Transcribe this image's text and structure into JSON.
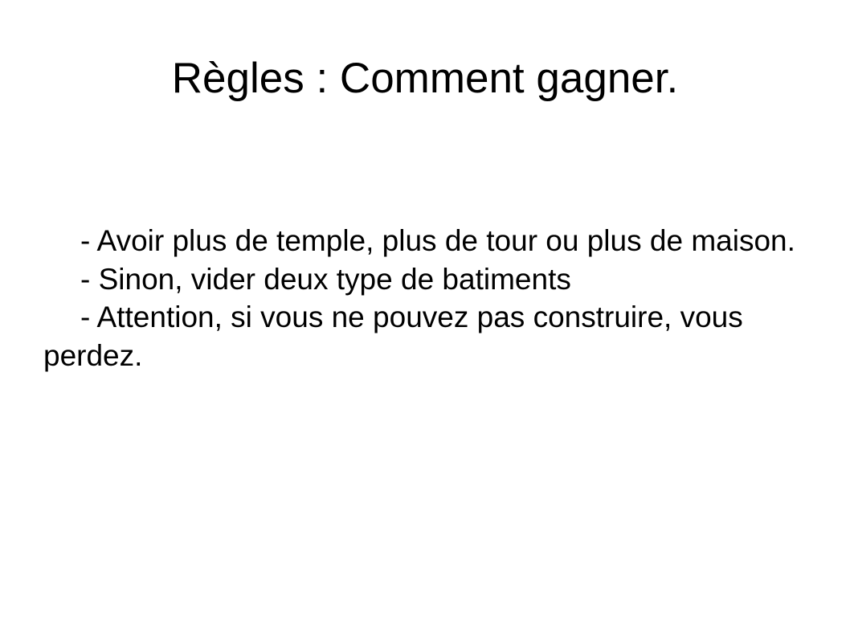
{
  "slide": {
    "title": "Règles : Comment gagner.",
    "bullets": [
      "- Avoir plus de temple, plus de tour ou plus de maison.",
      "- Sinon, vider deux type de batiments",
      "- Attention, si vous ne pouvez pas construire, vous perdez."
    ]
  }
}
